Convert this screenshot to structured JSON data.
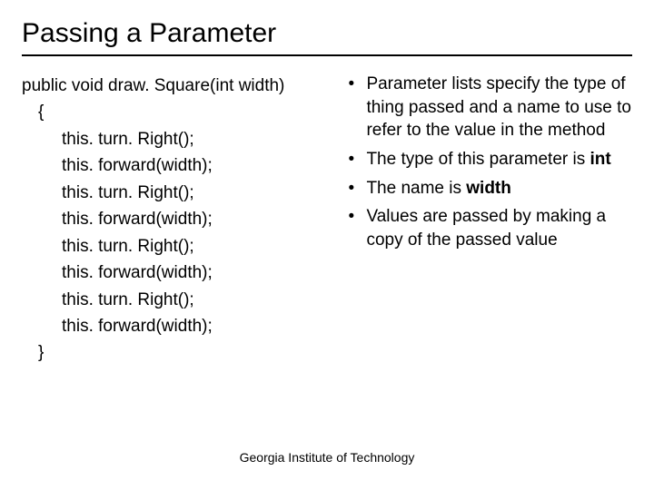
{
  "title": "Passing a Parameter",
  "code": {
    "signature": "public void draw. Square(int width)",
    "open_brace": "{",
    "lines": [
      "this. turn. Right();",
      "this. forward(width);",
      "this. turn. Right();",
      "this. forward(width);",
      "this. turn. Right();",
      "this. forward(width);",
      "this. turn. Right();",
      "this. forward(width);"
    ],
    "close_brace": "}"
  },
  "bullets": {
    "b0": "Parameter lists specify the type of thing passed and a name to use to refer to the value in the method",
    "b1_pre": "The type of this parameter is ",
    "b1_strong": "int",
    "b2_pre": "The name is ",
    "b2_strong": "width",
    "b3": "Values are passed by making a copy of the passed value"
  },
  "footer": "Georgia Institute of Technology"
}
